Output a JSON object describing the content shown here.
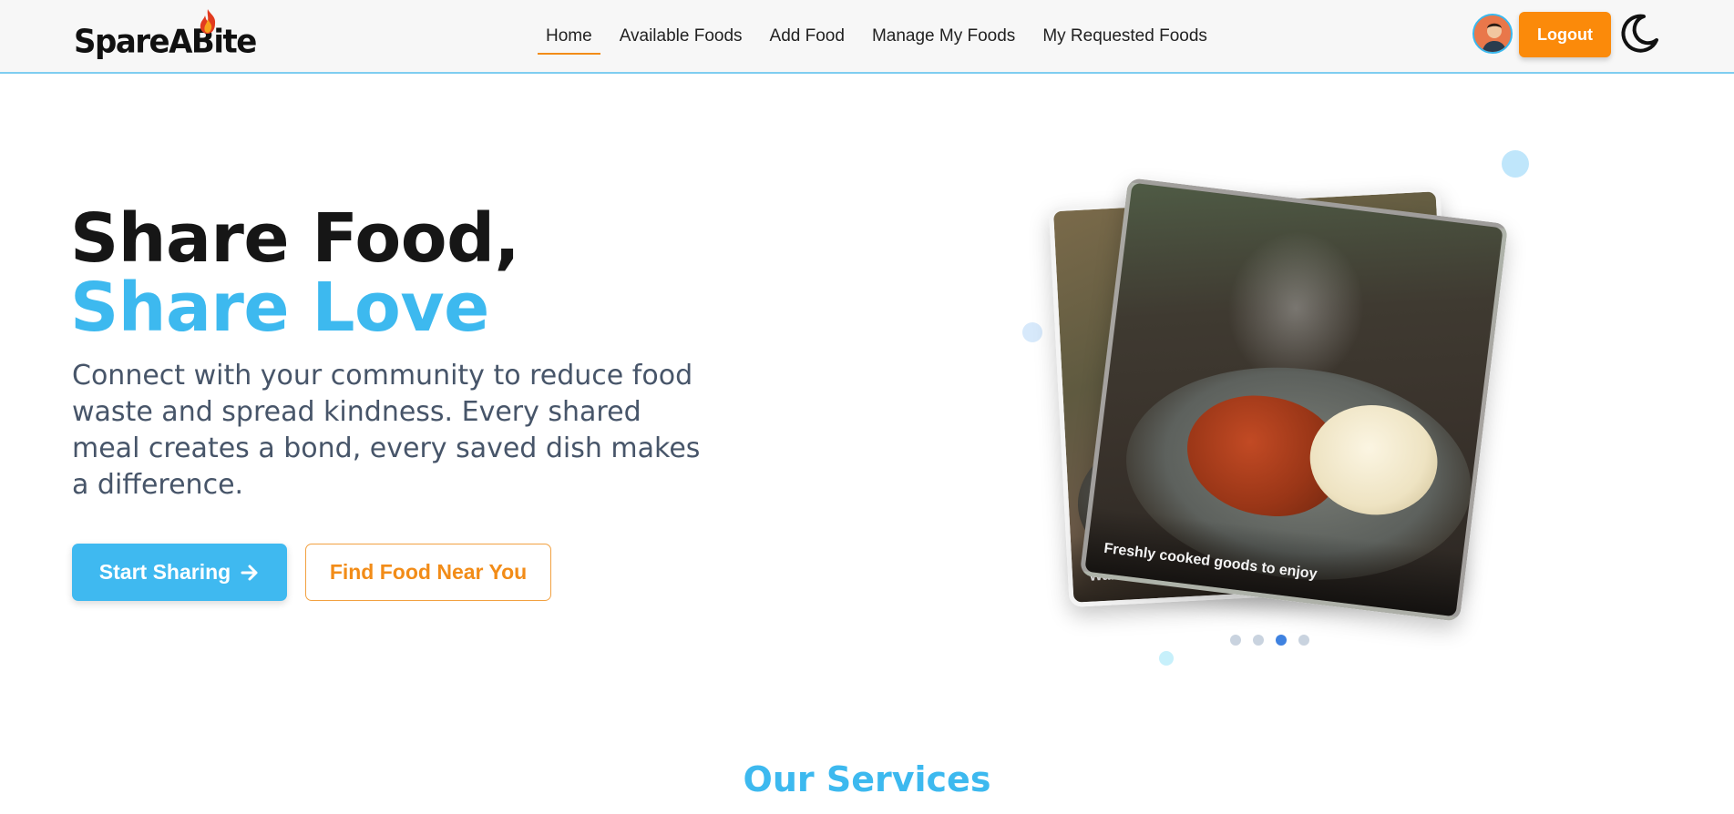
{
  "brand": {
    "name": "SpareABite"
  },
  "nav": {
    "links": [
      {
        "label": "Home",
        "active": true
      },
      {
        "label": "Available Foods",
        "active": false
      },
      {
        "label": "Add Food",
        "active": false
      },
      {
        "label": "Manage My Foods",
        "active": false
      },
      {
        "label": "My Requested Foods",
        "active": false
      }
    ],
    "logout_label": "Logout",
    "avatar_icon": "user-avatar",
    "theme_icon": "moon-icon"
  },
  "hero": {
    "title_line1": "Share Food,",
    "title_line2": "Share Love",
    "subtitle": "Connect with your community to reduce food waste and spread kindness. Every shared meal creates a bond, every saved dish makes a difference.",
    "primary_button": "Start Sharing",
    "secondary_button": "Find Food Near You"
  },
  "carousel": {
    "front_caption": "Freshly cooked goods to enjoy",
    "back_caption": "Warm comfort food to share",
    "total_slides": 4,
    "active_index": 2
  },
  "services": {
    "title": "Our Services"
  },
  "colors": {
    "accent_blue": "#3db9ef",
    "accent_orange": "#fb8a0a",
    "dot_active": "#3f82e0"
  }
}
